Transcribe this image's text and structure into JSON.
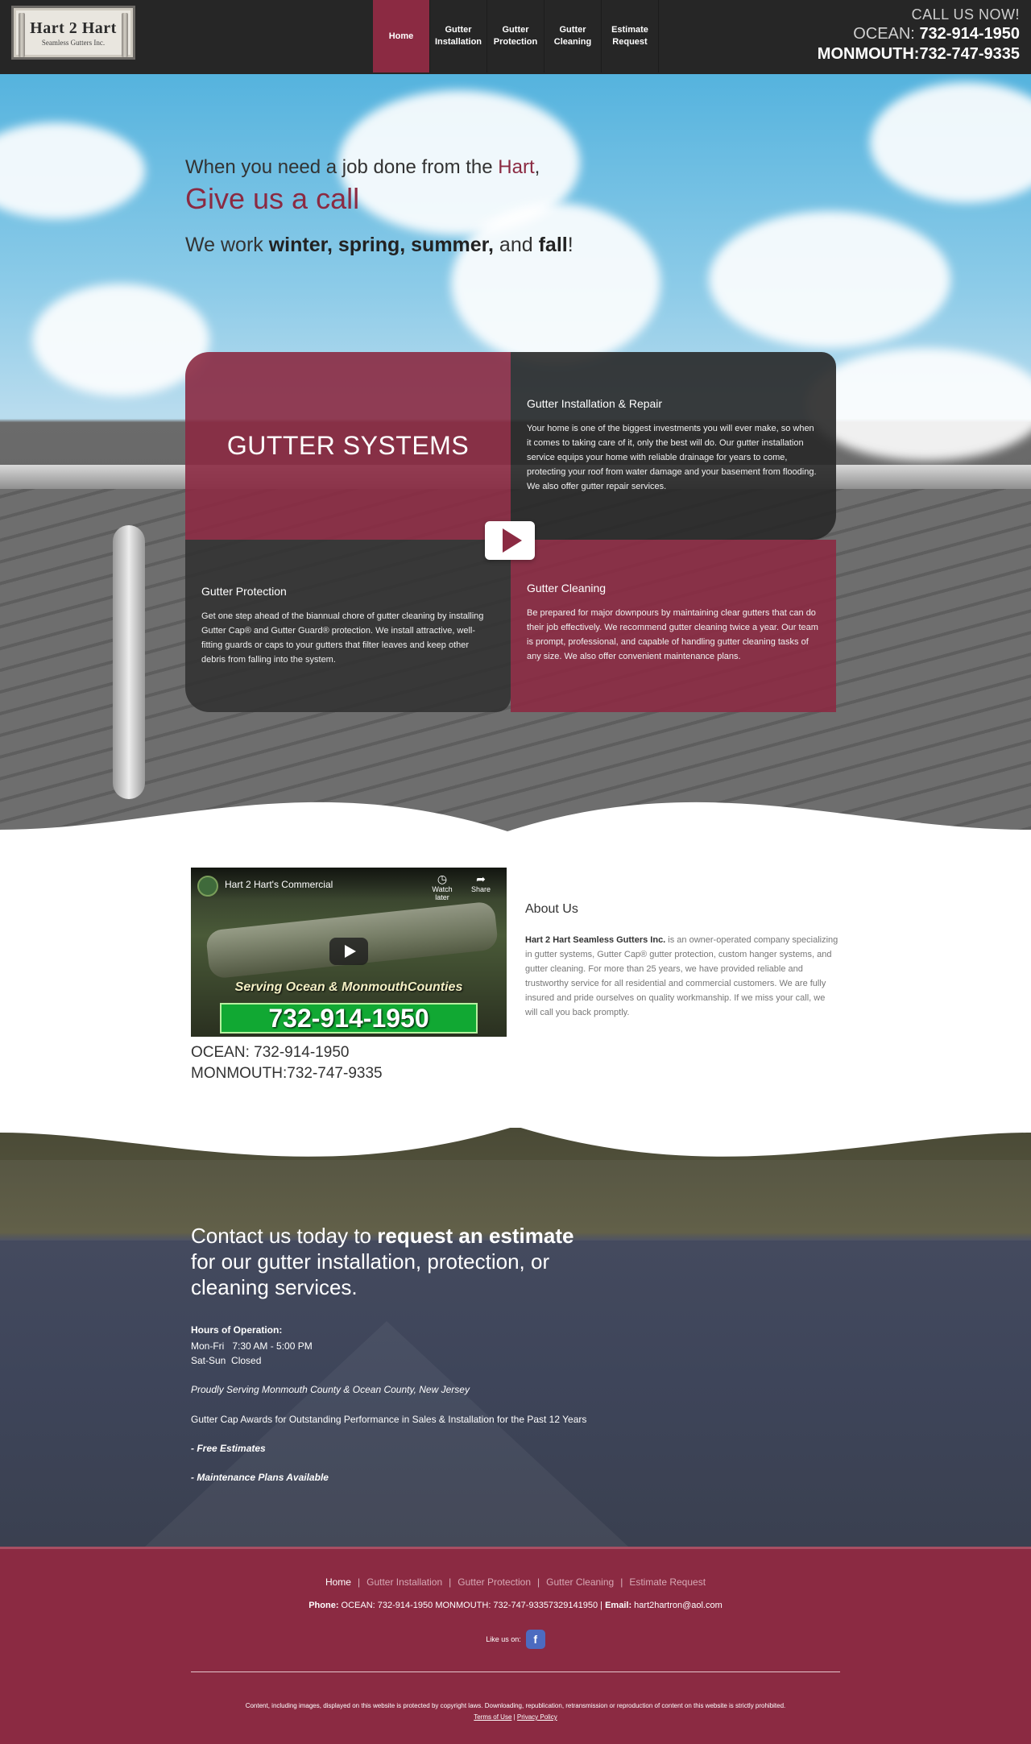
{
  "header": {
    "logo_main": "Hart 2 Hart",
    "logo_sub": "Seamless Gutters Inc.",
    "nav": [
      {
        "label": "Home",
        "active": true
      },
      {
        "label": "Gutter Installation",
        "active": false
      },
      {
        "label": "Gutter Protection",
        "active": false
      },
      {
        "label": "Gutter Cleaning",
        "active": false
      },
      {
        "label": "Estimate Request",
        "active": false
      }
    ],
    "call_now": "CALL US NOW!",
    "ocean_label": "OCEAN:",
    "ocean_phone": "732-914-1950",
    "monmouth_label": "MONMOUTH:",
    "monmouth_phone": "732-747-9335"
  },
  "hero": {
    "line1_pre": "When you need a job done from the ",
    "line1_accent": "Hart",
    "line1_post": ",",
    "line2": "Give us a call",
    "line3_pre": "We work ",
    "line3_seasons": "winter, spring, summer,",
    "line3_and": " and ",
    "line3_fall": "fall",
    "line3_end": "!"
  },
  "panels": {
    "systems": "GUTTER SYSTEMS",
    "installation": {
      "title": "Gutter Installation & Repair",
      "text": "Your home is one of the biggest investments you will ever make, so when it comes to taking care of it, only the best will do. Our gutter installation service equips your home with reliable drainage for years to come, protecting your roof from water damage and your basement from flooding. We also offer gutter repair services."
    },
    "protection": {
      "title": "Gutter Protection",
      "text": "Get one step ahead of the biannual chore of gutter cleaning by installing Gutter Cap® and Gutter Guard® protection. We install attractive, well-fitting guards or caps to your gutters that filter leaves and keep other debris from falling into the system."
    },
    "cleaning": {
      "title": "Gutter Cleaning",
      "text": "Be prepared for major downpours by maintaining clear gutters that can do their job effectively. We recommend gutter cleaning twice a year. Our team is prompt, professional, and capable of handling gutter cleaning tasks of any size. We also offer convenient maintenance plans."
    }
  },
  "about": {
    "video_title": "Hart 2 Hart's Commercial",
    "video_watch": "Watch later",
    "video_share": "Share",
    "video_serving": "Serving Ocean & MonmouthCounties",
    "video_phone": "732-914-1950",
    "phone_ocean": "OCEAN: 732-914-1950",
    "phone_monmouth": "MONMOUTH:732-747-9335",
    "title": "About Us",
    "company": "Hart 2 Hart Seamless Gutters Inc.",
    "text": " is an owner-operated company specializing in gutter systems, Gutter Cap® gutter protection, custom hanger systems, and gutter cleaning. For more than 25 years, we have provided reliable and trustworthy service for all residential and commercial customers. We are fully insured and pride ourselves on quality workmanship. If we miss your call, we will call you back promptly."
  },
  "contact": {
    "head_pre": "Contact us today to ",
    "head_bold": "request an estimate",
    "head_post": " for our gutter installation, protection, or cleaning services.",
    "hours_title": "Hours of Operation:",
    "hours_weekday": "Mon-Fri   7:30 AM - 5:00 PM",
    "hours_weekend": "Sat-Sun  Closed",
    "serving": "Proudly Serving Monmouth County & Ocean County, New Jersey",
    "awards": "Gutter Cap Awards for Outstanding Performance in Sales & Installation for the Past 12 Years",
    "free": "- Free Estimates",
    "plans": "- Maintenance Plans Available"
  },
  "footer": {
    "nav": [
      {
        "label": "Home",
        "current": true
      },
      {
        "label": "Gutter Installation",
        "current": false
      },
      {
        "label": "Gutter Protection",
        "current": false
      },
      {
        "label": "Gutter Cleaning",
        "current": false
      },
      {
        "label": "Estimate Request",
        "current": false
      }
    ],
    "phone_label": "Phone:",
    "phone_value": " OCEAN: 732-914-1950 MONMOUTH: 732-747-93357329141950 | ",
    "email_label": "Email:",
    "email_value": " hart2hartron@aol.com",
    "like_us": "Like us on:",
    "fb_glyph": "f",
    "copyright": "Content, including images, displayed on this website is protected by copyright laws. Downloading, republication, retransmission or reproduction of content on this website is strictly prohibited. ",
    "terms": "Terms of Use",
    "sep": " | ",
    "privacy": "Privacy Policy"
  },
  "colors": {
    "brand": "#8b2a42",
    "header_bg": "#262626",
    "panel_dark": "#282828"
  }
}
